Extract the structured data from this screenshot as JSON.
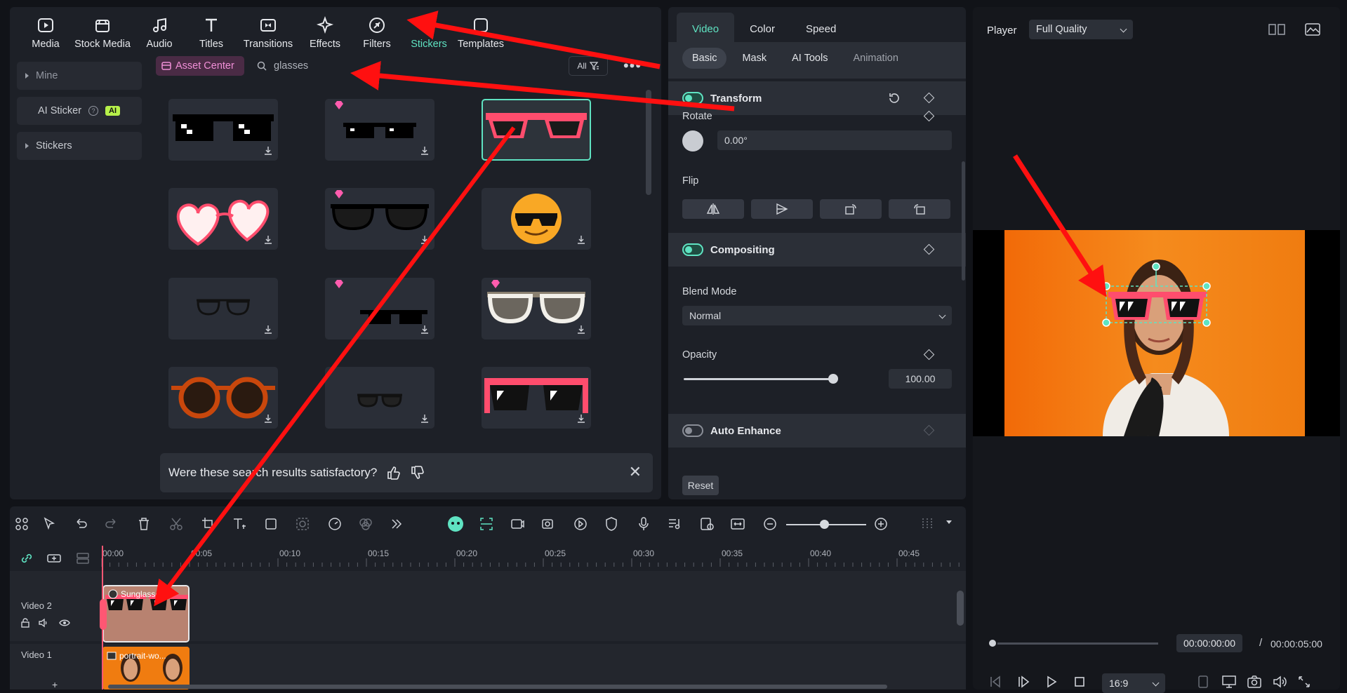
{
  "toolbar": {
    "items": [
      {
        "label": "Media",
        "icon": "media-icon"
      },
      {
        "label": "Stock Media",
        "icon": "stock-media-icon"
      },
      {
        "label": "Audio",
        "icon": "music-note-icon"
      },
      {
        "label": "Titles",
        "icon": "text-t-icon"
      },
      {
        "label": "Transitions",
        "icon": "transitions-icon"
      },
      {
        "label": "Effects",
        "icon": "sparkle-icon"
      },
      {
        "label": "Filters",
        "icon": "filter-icon"
      },
      {
        "label": "Stickers",
        "icon": "sticker-icon"
      },
      {
        "label": "Templates",
        "icon": "templates-icon"
      }
    ],
    "active_color": "#5fe3c2"
  },
  "sidebar": {
    "items": [
      {
        "label": "Mine"
      },
      {
        "label": "AI Sticker",
        "badge": "AI"
      },
      {
        "label": "Stickers"
      }
    ]
  },
  "search": {
    "asset_center_label": "Asset Center",
    "query": "glasses",
    "filter_label": "All"
  },
  "feedback": {
    "text": "Were these search results satisfactory?"
  },
  "properties": {
    "tabs": [
      "Video",
      "Color",
      "Speed"
    ],
    "subtabs": [
      "Basic",
      "Mask",
      "AI Tools",
      "Animation"
    ],
    "transform_label": "Transform",
    "rotate_label": "Rotate",
    "rotate_value": "0.00°",
    "flip_label": "Flip",
    "compositing_label": "Compositing",
    "blend_mode_label": "Blend Mode",
    "blend_mode_value": "Normal",
    "opacity_label": "Opacity",
    "opacity_value": "100.00",
    "opacity_level": 1.0,
    "auto_enhance_label": "Auto Enhance",
    "reset_label": "Reset"
  },
  "player": {
    "title": "Player",
    "quality": "Full Quality",
    "current_time": "00:00:00:00",
    "separator": "/",
    "total_time": "00:00:05:00",
    "aspect_ratio": "16:9",
    "progress": 0.0
  },
  "timeline": {
    "ruler_labels": [
      "00:00",
      "00:05",
      "00:10",
      "00:15",
      "00:20",
      "00:25",
      "00:30",
      "00:35",
      "00:40",
      "00:45"
    ],
    "tracks": [
      {
        "name": "Video 2",
        "clip_label": "Sunglasse..."
      },
      {
        "name": "Video 1",
        "clip_label": "portrait-wo..."
      }
    ]
  },
  "colors": {
    "accent": "#5fe3c2",
    "asset_center": "#f08fd7",
    "annotation_arrow": "#ff1010",
    "playhead": "#ff5773"
  }
}
